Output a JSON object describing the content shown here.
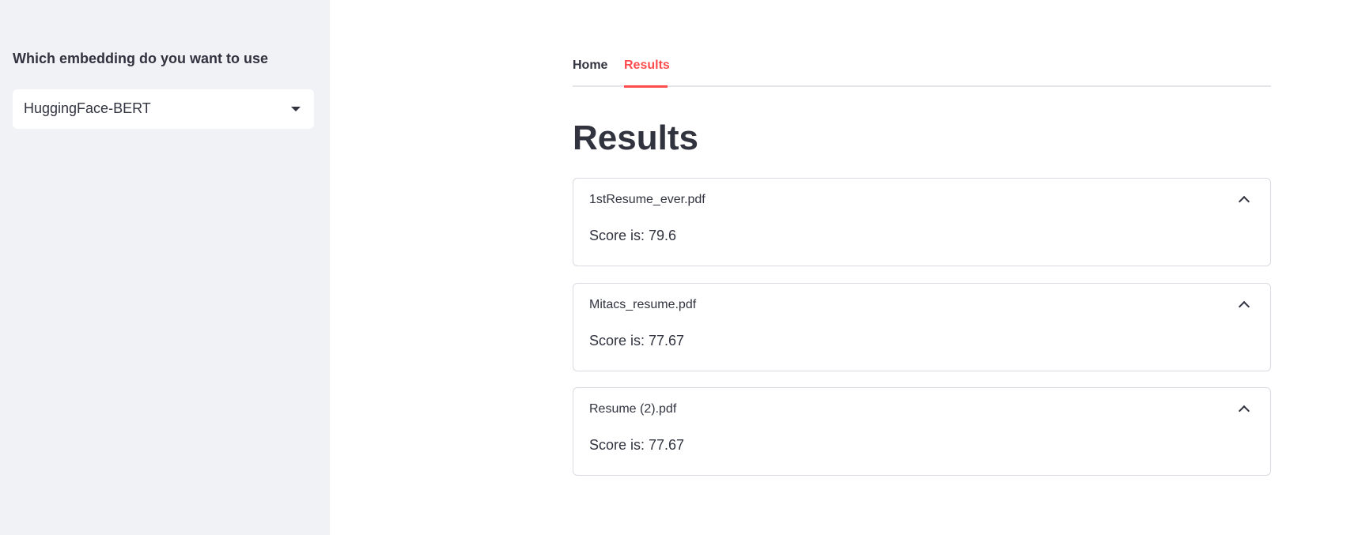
{
  "sidebar": {
    "label": "Which embedding do you want to use",
    "select": {
      "value": "HuggingFace-BERT"
    }
  },
  "tabs": [
    {
      "label": "Home",
      "active": false
    },
    {
      "label": "Results",
      "active": true
    }
  ],
  "page": {
    "title": "Results"
  },
  "results": [
    {
      "filename": "1stResume_ever.pdf",
      "score_text": "Score is: 79.6"
    },
    {
      "filename": "Mitacs_resume.pdf",
      "score_text": "Score is: 77.67"
    },
    {
      "filename": "Resume (2).pdf",
      "score_text": "Score is: 77.67"
    }
  ],
  "colors": {
    "sidebar_bg": "#f0f2f6",
    "accent": "#ff4b4b",
    "text": "#31333f",
    "border": "#d9dbe0"
  },
  "icons": {
    "select_caret": "caret-down-icon",
    "expander_toggle": "chevron-up-icon"
  }
}
